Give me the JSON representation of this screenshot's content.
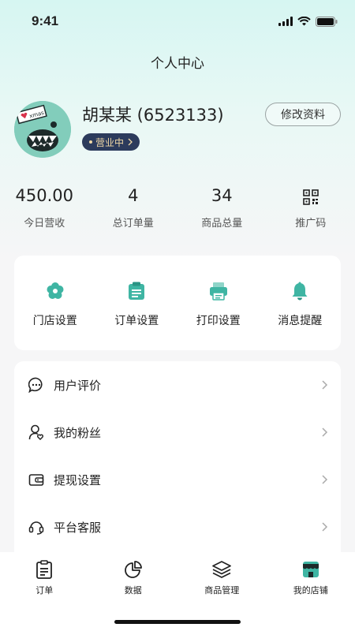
{
  "status_bar": {
    "time": "9:41"
  },
  "header": {
    "title": "个人中心"
  },
  "profile": {
    "name": "胡某某 (6523133)",
    "status": "营业中",
    "edit_label": "修改资料",
    "avatar_sticker_text": "xmas"
  },
  "stats": [
    {
      "value": "450.00",
      "label": "今日营收"
    },
    {
      "value": "4",
      "label": "总订单量"
    },
    {
      "value": "34",
      "label": "商品总量"
    },
    {
      "icon": "qr-code-icon",
      "label": "推广码"
    }
  ],
  "settings": [
    {
      "icon": "gear-icon",
      "label": "门店设置"
    },
    {
      "icon": "clipboard-icon",
      "label": "订单设置"
    },
    {
      "icon": "printer-icon",
      "label": "打印设置"
    },
    {
      "icon": "bell-icon",
      "label": "消息提醒"
    }
  ],
  "menu": [
    {
      "icon": "chat-icon",
      "label": "用户评价"
    },
    {
      "icon": "user-heart-icon",
      "label": "我的粉丝"
    },
    {
      "icon": "wallet-icon",
      "label": "提现设置"
    },
    {
      "icon": "headset-icon",
      "label": "平台客服"
    }
  ],
  "tabbar": [
    {
      "icon": "orders-icon",
      "label": "订单"
    },
    {
      "icon": "pie-chart-icon",
      "label": "数据"
    },
    {
      "icon": "layers-icon",
      "label": "商品管理"
    },
    {
      "icon": "store-icon",
      "label": "我的店铺"
    }
  ],
  "colors": {
    "accent": "#3fb5a3",
    "pill_bg": "#2c3b5c",
    "pill_text": "#f1d9a6"
  }
}
